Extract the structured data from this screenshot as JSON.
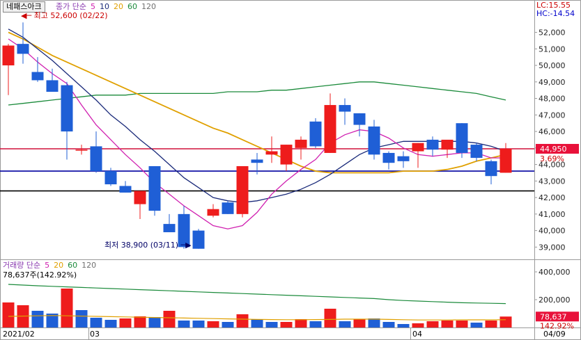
{
  "header": {
    "stock_name": "네패스아크",
    "legend_prefix": "종가 단순",
    "ma_periods": [
      "5",
      "10",
      "20",
      "60",
      "120"
    ],
    "lc_label": "LC:15.55",
    "hc_label": "HC:-14.54"
  },
  "volume_header": {
    "title": "거래량 단순",
    "ma_periods": [
      "5",
      "20",
      "60",
      "120"
    ],
    "current_text": "78,637주(142.92%)"
  },
  "annotations": {
    "high": "최고 52,600 (02/22)",
    "low": "최저 38,900 (03/11)"
  },
  "colors": {
    "up": "#ee1c1c",
    "down": "#1f5fd6",
    "ma5": "#d020b0",
    "ma10": "#1a2a7a",
    "ma20": "#e0a000",
    "ma60": "#1a8a3a",
    "ma120": "#707070",
    "current_line": "#d0103a",
    "blue_line": "#0000a0",
    "black_line": "#000000"
  },
  "chart_data": [
    {
      "type": "candlestick",
      "ylim": [
        38300,
        53200
      ],
      "y_ticks": [
        "39,000",
        "40,000",
        "41,000",
        "42,000",
        "43,000",
        "44,000",
        "45,000",
        "46,000",
        "47,000",
        "48,000",
        "49,000",
        "50,000",
        "51,000",
        "52,000"
      ],
      "candles": [
        {
          "o": 50000,
          "h": 51300,
          "l": 48200,
          "c": 51200
        },
        {
          "o": 51300,
          "h": 52600,
          "l": 50100,
          "c": 50700
        },
        {
          "o": 49600,
          "h": 50500,
          "l": 49000,
          "c": 49100
        },
        {
          "o": 49100,
          "h": 49800,
          "l": 48400,
          "c": 48400
        },
        {
          "o": 48800,
          "h": 49000,
          "l": 44300,
          "c": 46000
        },
        {
          "o": 44900,
          "h": 45200,
          "l": 44600,
          "c": 44900
        },
        {
          "o": 45100,
          "h": 46000,
          "l": 43500,
          "c": 43600
        },
        {
          "o": 43600,
          "h": 43800,
          "l": 42700,
          "c": 42800
        },
        {
          "o": 42700,
          "h": 43000,
          "l": 42300,
          "c": 42300
        },
        {
          "o": 41600,
          "h": 42300,
          "l": 40700,
          "c": 42400
        },
        {
          "o": 43900,
          "h": 43900,
          "l": 40900,
          "c": 41200
        },
        {
          "o": 40400,
          "h": 41000,
          "l": 39900,
          "c": 39900
        },
        {
          "o": 41000,
          "h": 41500,
          "l": 38900,
          "c": 39000
        },
        {
          "o": 40000,
          "h": 40100,
          "l": 38900,
          "c": 38900
        },
        {
          "o": 40900,
          "h": 41600,
          "l": 40800,
          "c": 41300
        },
        {
          "o": 41700,
          "h": 41800,
          "l": 41000,
          "c": 41000
        },
        {
          "o": 41000,
          "h": 43900,
          "l": 40800,
          "c": 43900
        },
        {
          "o": 44300,
          "h": 44700,
          "l": 43400,
          "c": 44100
        },
        {
          "o": 44600,
          "h": 45700,
          "l": 44100,
          "c": 44800
        },
        {
          "o": 44000,
          "h": 45200,
          "l": 43600,
          "c": 45200
        },
        {
          "o": 45000,
          "h": 45700,
          "l": 44300,
          "c": 45500
        },
        {
          "o": 46600,
          "h": 46800,
          "l": 45000,
          "c": 45100
        },
        {
          "o": 44700,
          "h": 48300,
          "l": 44700,
          "c": 47600
        },
        {
          "o": 47600,
          "h": 48000,
          "l": 46400,
          "c": 47200
        },
        {
          "o": 47100,
          "h": 47100,
          "l": 45700,
          "c": 46400
        },
        {
          "o": 46300,
          "h": 46700,
          "l": 44300,
          "c": 44600
        },
        {
          "o": 44700,
          "h": 44800,
          "l": 43700,
          "c": 44100
        },
        {
          "o": 44500,
          "h": 44800,
          "l": 43800,
          "c": 44200
        },
        {
          "o": 44800,
          "h": 45300,
          "l": 43800,
          "c": 45300
        },
        {
          "o": 45500,
          "h": 45700,
          "l": 44500,
          "c": 44900
        },
        {
          "o": 44900,
          "h": 45500,
          "l": 44400,
          "c": 45500
        },
        {
          "o": 46500,
          "h": 46500,
          "l": 44400,
          "c": 44700
        },
        {
          "o": 45200,
          "h": 45300,
          "l": 44200,
          "c": 44400
        },
        {
          "o": 44200,
          "h": 44300,
          "l": 42800,
          "c": 43300
        },
        {
          "o": 43500,
          "h": 45300,
          "l": 43500,
          "c": 44950
        }
      ],
      "ma5": [
        51600,
        51000,
        50200,
        49500,
        48900,
        47600,
        46400,
        45500,
        44600,
        43800,
        42900,
        42200,
        41500,
        40900,
        40300,
        40100,
        40300,
        41100,
        42200,
        43000,
        43700,
        44300,
        45300,
        45800,
        46100,
        46000,
        45600,
        45000,
        44600,
        44500,
        44600,
        44700,
        44700,
        44400,
        44400
      ],
      "ma10": [
        52200,
        51700,
        51000,
        50300,
        49500,
        48700,
        47900,
        47000,
        46300,
        45500,
        44800,
        44000,
        43200,
        42600,
        42000,
        41800,
        41700,
        41800,
        42000,
        42200,
        42500,
        42900,
        43400,
        44000,
        44600,
        45000,
        45200,
        45400,
        45400,
        45400,
        45400,
        45400,
        45300,
        45100,
        44800
      ],
      "ma20": [
        52000,
        51600,
        51100,
        50600,
        50200,
        49800,
        49400,
        49000,
        48600,
        48200,
        47800,
        47400,
        47000,
        46600,
        46200,
        45900,
        45500,
        45100,
        44700,
        44300,
        43900,
        43600,
        43500,
        43500,
        43500,
        43500,
        43500,
        43600,
        43600,
        43600,
        43700,
        43900,
        44200,
        44400,
        44600
      ],
      "ma60": [
        47600,
        47700,
        47800,
        47900,
        48000,
        48100,
        48200,
        48200,
        48200,
        48300,
        48300,
        48300,
        48300,
        48300,
        48300,
        48400,
        48400,
        48400,
        48500,
        48500,
        48600,
        48700,
        48800,
        48900,
        49000,
        49000,
        48900,
        48800,
        48700,
        48600,
        48500,
        48400,
        48300,
        48100,
        47900
      ],
      "hlines": [
        {
          "value": 44950,
          "label": "44,950",
          "pct": "3.69%"
        },
        {
          "value": 43600
        },
        {
          "value": 42400
        }
      ]
    },
    {
      "type": "bar",
      "ylim": [
        0,
        480000
      ],
      "y_ticks": [
        "200,000",
        "400,000"
      ],
      "current_label": "78,637",
      "current_pct": "142.92%",
      "values": [
        {
          "v": 180000,
          "up": true
        },
        {
          "v": 160000,
          "up": true
        },
        {
          "v": 120000,
          "up": false
        },
        {
          "v": 100000,
          "up": false
        },
        {
          "v": 280000,
          "up": true
        },
        {
          "v": 125000,
          "up": false
        },
        {
          "v": 70000,
          "up": false
        },
        {
          "v": 55000,
          "up": false
        },
        {
          "v": 65000,
          "up": true
        },
        {
          "v": 80000,
          "up": true
        },
        {
          "v": 75000,
          "up": false
        },
        {
          "v": 120000,
          "up": true
        },
        {
          "v": 50000,
          "up": false
        },
        {
          "v": 50000,
          "up": false
        },
        {
          "v": 45000,
          "up": true
        },
        {
          "v": 40000,
          "up": false
        },
        {
          "v": 95000,
          "up": true
        },
        {
          "v": 60000,
          "up": false
        },
        {
          "v": 40000,
          "up": false
        },
        {
          "v": 40000,
          "up": true
        },
        {
          "v": 60000,
          "up": true
        },
        {
          "v": 45000,
          "up": false
        },
        {
          "v": 135000,
          "up": true
        },
        {
          "v": 45000,
          "up": false
        },
        {
          "v": 60000,
          "up": true
        },
        {
          "v": 65000,
          "up": false
        },
        {
          "v": 40000,
          "up": false
        },
        {
          "v": 25000,
          "up": false
        },
        {
          "v": 30000,
          "up": true
        },
        {
          "v": 45000,
          "up": true
        },
        {
          "v": 50000,
          "up": true
        },
        {
          "v": 50000,
          "up": true
        },
        {
          "v": 35000,
          "up": false
        },
        {
          "v": 50000,
          "up": true
        },
        {
          "v": 78637,
          "up": true
        }
      ],
      "ma20": [
        310000,
        305000,
        300000,
        296000,
        292000,
        288000,
        284000,
        280000,
        276000,
        272000,
        268000,
        264000,
        260000,
        256000,
        252000,
        248000,
        244000,
        240000,
        236000,
        232000,
        228000,
        224000,
        220000,
        216000,
        212000,
        208000,
        200000,
        194000,
        190000,
        186000,
        182000,
        178000,
        176000,
        174000,
        172000
      ],
      "ma5": [
        80000,
        82000,
        84000,
        86000,
        84000,
        82000,
        80000,
        78000,
        76000,
        74000,
        72000,
        70000,
        68000,
        66000,
        64000,
        62000,
        60000,
        58000,
        57000,
        56000,
        56000,
        57000,
        58000,
        60000,
        60000,
        60000,
        58000,
        56000,
        54000,
        54000,
        54000,
        55000,
        55000,
        55000,
        56000
      ]
    }
  ],
  "x_axis": {
    "labels": [
      {
        "text": "2021/02",
        "index": 0
      },
      {
        "text": "03",
        "index": 6
      },
      {
        "text": "04",
        "index": 28
      },
      {
        "text": "04/09",
        "index": 34
      }
    ]
  }
}
